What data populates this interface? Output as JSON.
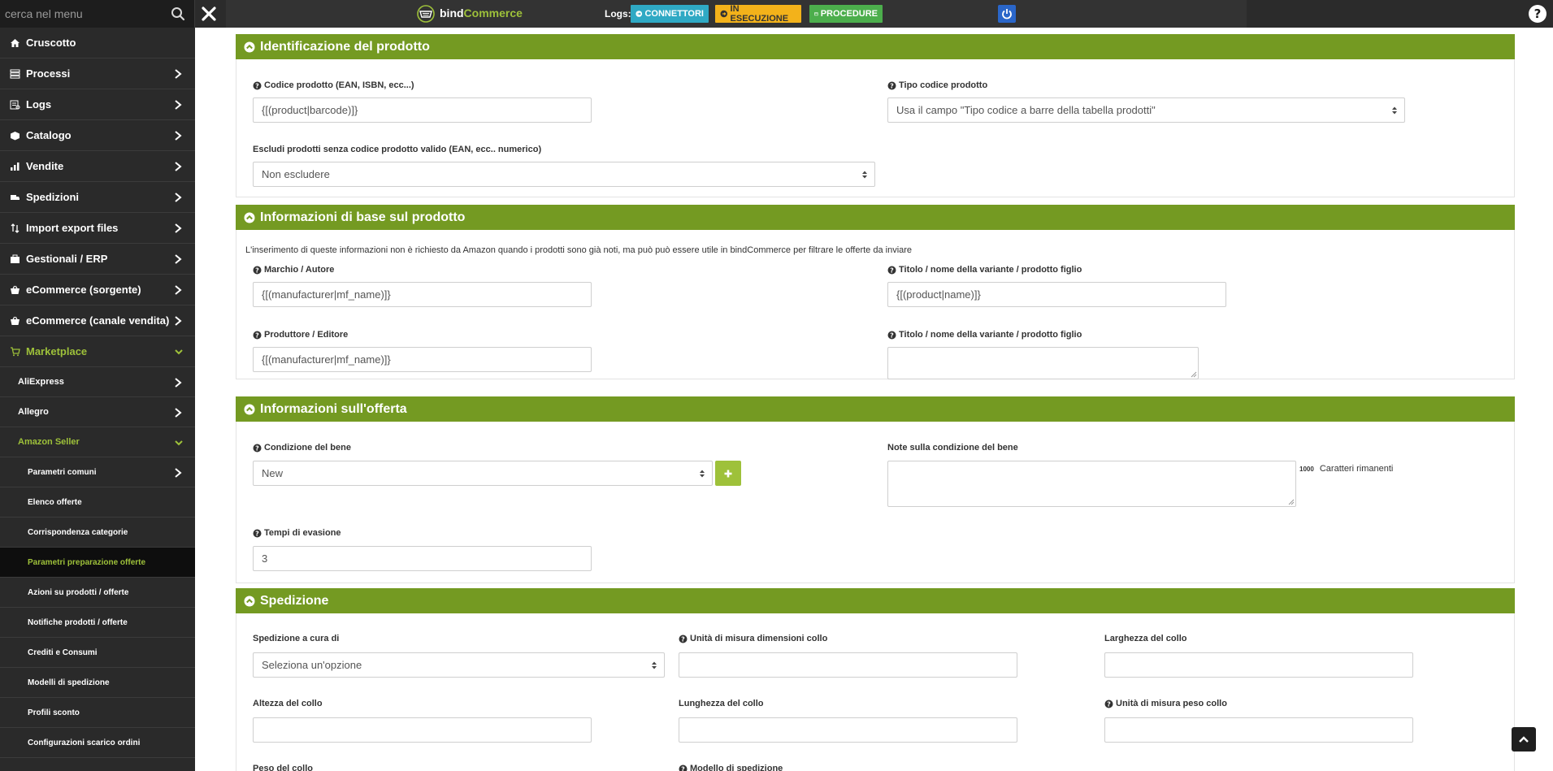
{
  "topbar": {
    "search_placeholder": "cerca nel menu",
    "logo_bind": "bind",
    "logo_commerce": "Commerce",
    "logs_label": "Logs:",
    "connettori": "CONNETTORI",
    "in_esecuzione": "IN ESECUZIONE",
    "procedure": "PROCEDURE"
  },
  "sidebar": {
    "items": [
      {
        "label": "Cruscotto",
        "icon": "home-icon"
      },
      {
        "label": "Processi",
        "icon": "processes-icon"
      },
      {
        "label": "Logs",
        "icon": "logs-icon"
      },
      {
        "label": "Catalogo",
        "icon": "catalog-icon"
      },
      {
        "label": "Vendite",
        "icon": "sales-icon"
      },
      {
        "label": "Spedizioni",
        "icon": "truck-icon"
      },
      {
        "label": "Import export files",
        "icon": "import-export-icon"
      },
      {
        "label": "Gestionali / ERP",
        "icon": "erp-icon"
      },
      {
        "label": "eCommerce (sorgente)",
        "icon": "basket-icon"
      },
      {
        "label": "eCommerce (canale vendita)",
        "icon": "basket-icon"
      },
      {
        "label": "Marketplace",
        "icon": "cart-icon"
      }
    ],
    "marketplace_children": [
      "AliExpress",
      "Allegro",
      "Amazon Seller"
    ],
    "amazon_children": [
      "Parametri comuni",
      "Elenco offerte",
      "Corrispondenza categorie",
      "Parametri preparazione offerte",
      "Azioni su prodotti / offerte",
      "Notifiche prodotti / offerte",
      "Crediti e Consumi",
      "Modelli di spedizione",
      "Profili sconto",
      "Configurazioni scarico ordini"
    ]
  },
  "sections": {
    "identificazione": {
      "title": "Identificazione del prodotto",
      "codice_label": "Codice prodotto (EAN, ISBN, ecc...)",
      "codice_value": "{[(product|barcode)]}",
      "tipo_label": "Tipo codice prodotto",
      "tipo_value": "Usa il campo \"Tipo codice a barre della tabella prodotti\"",
      "escludi_label": "Escludi prodotti senza codice prodotto valido (EAN, ecc.. numerico)",
      "escludi_value": "Non escludere"
    },
    "informazioni_base": {
      "title": "Informazioni di base sul prodotto",
      "info": "L'inserimento di queste informazioni non è richiesto da Amazon quando i prodotti sono già noti, ma può può essere utile in bindCommerce per filtrare le offerte da inviare",
      "marchio_label": "Marchio / Autore",
      "marchio_value": "{[(manufacturer|mf_name)]}",
      "titolo_label": "Titolo / nome della variante / prodotto figlio",
      "titolo_value": "{[(product|name)]}",
      "produttore_label": "Produttore / Editore",
      "produttore_value": "{[(manufacturer|mf_name)]}",
      "titolo2_label": "Titolo / nome della variante / prodotto figlio"
    },
    "offerta": {
      "title": "Informazioni sull'offerta",
      "condizione_label": "Condizione del bene",
      "condizione_value": "New",
      "note_label": "Note sulla condizione del bene",
      "chars_count": "1000",
      "chars_label": "Caratteri rimanenti",
      "tempi_label": "Tempi di evasione",
      "tempi_value": "3"
    },
    "spedizione": {
      "title": "Spedizione",
      "cura_label": "Spedizione a cura di",
      "cura_value": "Seleziona un'opzione",
      "unita_dim_label": "Unità di misura dimensioni collo",
      "larghezza_label": "Larghezza del collo",
      "altezza_label": "Altezza del collo",
      "lunghezza_label": "Lunghezza del collo",
      "unita_peso_label": "Unità di misura peso collo",
      "peso_label": "Peso del collo",
      "modello_label": "Modello di spedizione"
    }
  },
  "colors": {
    "accent_green": "#749a22",
    "light_green": "#9ec13a",
    "sidebar_bg": "#2a2a2a",
    "topbar_bg": "#2b2b2b"
  }
}
